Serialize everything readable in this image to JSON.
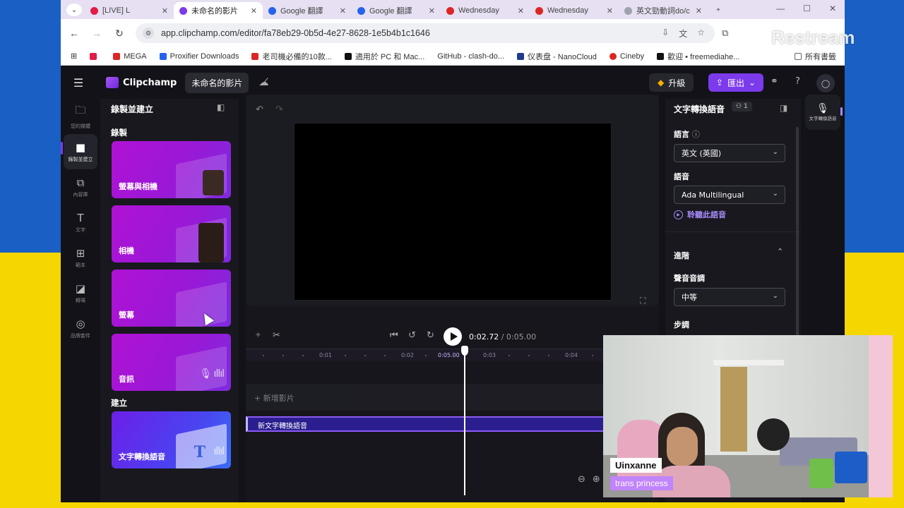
{
  "browser": {
    "tabs": [
      {
        "label": "[LIVE] L",
        "color": "#e11d48",
        "active": false
      },
      {
        "label": "未命名的影片",
        "color": "#7c3aed",
        "active": true
      },
      {
        "label": "Google 翻譯",
        "color": "#2563eb",
        "active": false
      },
      {
        "label": "Google 翻譯",
        "color": "#2563eb",
        "active": false
      },
      {
        "label": "Wednesday",
        "color": "#dc2626",
        "active": false
      },
      {
        "label": "Wednesday",
        "color": "#dc2626",
        "active": false
      },
      {
        "label": "英文勁動詞do/c",
        "color": "#9ca3af",
        "active": false
      }
    ],
    "url": "app.clipchamp.com/editor/fa78eb29-0b5d-4e27-8628-1e5b4b1c1646",
    "bookmarks": [
      {
        "label": "",
        "color": "#e11d48"
      },
      {
        "label": "MEGA",
        "color": "#dc2626"
      },
      {
        "label": "Proxifier Downloads",
        "color": "#2563eb"
      },
      {
        "label": "老司機必備的10款...",
        "color": "#dc2626"
      },
      {
        "label": "適用於 PC 和 Mac...",
        "color": "#111111"
      },
      {
        "label": "GitHub - clash-do...",
        "color": "#ffffff"
      },
      {
        "label": "仪表盘 - NanoCloud",
        "color": "#1e3a8a"
      },
      {
        "label": "Cineby",
        "color": "#dc2626"
      },
      {
        "label": "歡迎 • freemediahe...",
        "color": "#111111"
      }
    ],
    "all_bookmarks_label": "所有書籤",
    "watermark": "Restream"
  },
  "app": {
    "brand": "Clipchamp",
    "project_name": "未命名的影片",
    "upgrade_label": "升級",
    "export_label": "匯出",
    "rail": [
      {
        "label": "您的媒體",
        "icon": "folder-icon"
      },
      {
        "label": "錄製並建立",
        "icon": "camera-icon",
        "active": true
      },
      {
        "label": "內容庫",
        "icon": "library-icon"
      },
      {
        "label": "文字",
        "icon": "text-icon"
      },
      {
        "label": "範本",
        "icon": "templates-icon"
      },
      {
        "label": "轉場",
        "icon": "transitions-icon"
      },
      {
        "label": "品牌套件",
        "icon": "brand-kit-icon"
      }
    ],
    "panel": {
      "title": "錄製並建立",
      "section_record": "錄製",
      "section_create": "建立",
      "cards": [
        "螢幕與相機",
        "相機",
        "螢幕",
        "音訊",
        "文字轉換語音"
      ]
    },
    "editor": {
      "time_current": "0:02.72",
      "time_total": "/ 0:05.00",
      "ruler_ticks": [
        "0:01",
        "0:02",
        "0:05.00",
        "0:03",
        "0:04"
      ],
      "add_media_label": "+ 新增影片",
      "clip_label": "新文字轉換語音"
    },
    "right_panel": {
      "title": "文字轉換語音",
      "badge": "1",
      "language_label": "語言",
      "language_value": "英文 (英國)",
      "voice_label": "語音",
      "voice_value": "Ada Multilingual",
      "listen_label": "聆聽此語音",
      "advanced_label": "進階",
      "pitch_label": "聲音音調",
      "pitch_value": "中等",
      "pace_label": "步調",
      "rail_label": "文字轉換語音"
    }
  },
  "webcam": {
    "name": "Uinxanne",
    "tagline": "trans princess"
  }
}
